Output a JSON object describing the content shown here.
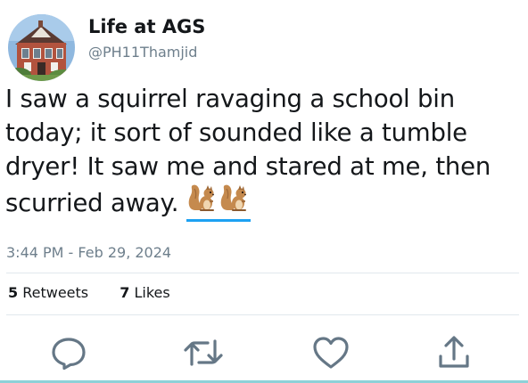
{
  "account": {
    "display_name": "Life at AGS",
    "handle": "@PH11Thamjid"
  },
  "tweet": {
    "lines": [
      "I saw a squirrel ravaging a school bin",
      "today; it sort of sounded like a tumble",
      "dryer! It saw me and stared at me, then",
      "scurried away. "
    ],
    "emoji": [
      "squirrel-emoji",
      "squirrel-emoji"
    ],
    "timestamp": "3:44 PM - Feb 29, 2024"
  },
  "stats": {
    "retweets_count": "5",
    "retweets_label": "Retweets",
    "likes_count": "7",
    "likes_label": "Likes"
  },
  "actions": [
    "reply-icon",
    "retweet-icon",
    "like-icon",
    "share-icon"
  ],
  "colors": {
    "text": "#14171a",
    "muted": "#6e7f8c",
    "divider": "#e1e8ed",
    "link": "#1da1f2",
    "icon": "#657786",
    "bottom_rule": "#8ed1d8"
  }
}
